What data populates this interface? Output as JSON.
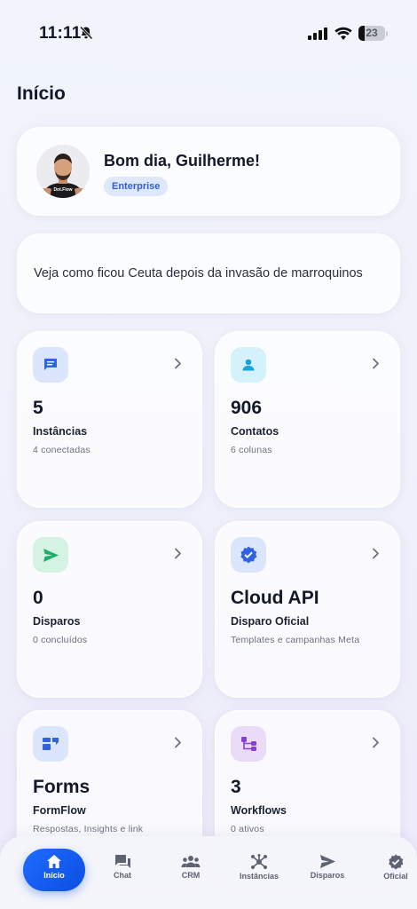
{
  "status_bar": {
    "time": "11:11",
    "battery": "23",
    "battery_fraction": 0.23
  },
  "page": {
    "title": "Início"
  },
  "profile": {
    "greeting": "Bom dia, Guilherme!",
    "plan": "Enterprise",
    "shirt_text": "Dot.Flow"
  },
  "news": {
    "ticker": "Veja como ficou Ceuta depois da invasão de marroquinos"
  },
  "stats": [
    {
      "value": "5",
      "label": "Instâncias",
      "sub": "4 conectadas",
      "icon": "chat-bubble-icon",
      "color": "#2f63e0",
      "bg": "#dbe5fc"
    },
    {
      "value": "906",
      "label": "Contatos",
      "sub": "6 colunas",
      "icon": "person-icon",
      "color": "#1aa3d6",
      "bg": "#d5f1fb"
    },
    {
      "value": "0",
      "label": "Disparos",
      "sub": "0 concluídos",
      "icon": "send-icon",
      "color": "#1fae6a",
      "bg": "#d4f3e2"
    },
    {
      "value": "Cloud API",
      "label": "Disparo Oficial",
      "sub": "Templates e campanhas Meta",
      "icon": "verified-badge-icon",
      "color": "#2f63e0",
      "bg": "#dbe5fc"
    },
    {
      "value": "Forms",
      "label": "FormFlow",
      "sub": "Respostas, Insights e link",
      "icon": "form-icon",
      "color": "#2f63e0",
      "bg": "#dbe5fc"
    },
    {
      "value": "3",
      "label": "Workflows",
      "sub": "0 ativos",
      "icon": "workflow-icon",
      "color": "#8a3fd6",
      "bg": "#eadcf8"
    }
  ],
  "tabs": [
    {
      "label": "Início",
      "icon": "home-icon"
    },
    {
      "label": "Chat",
      "icon": "chat-icon"
    },
    {
      "label": "CRM",
      "icon": "people-icon"
    },
    {
      "label": "Instâncias",
      "icon": "hub-icon"
    },
    {
      "label": "Disparos",
      "icon": "send-icon"
    },
    {
      "label": "Oficial",
      "icon": "verified-badge-icon"
    }
  ]
}
